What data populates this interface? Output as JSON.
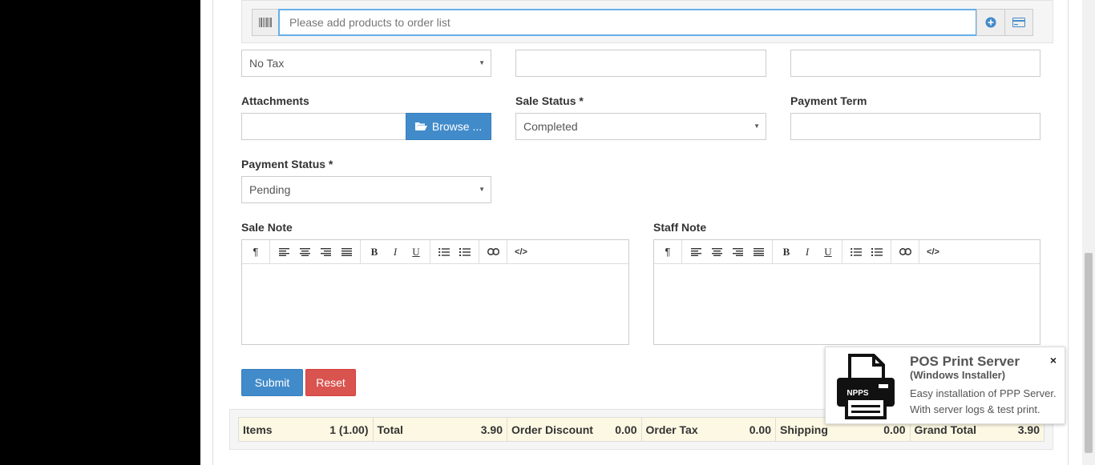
{
  "product_search": {
    "placeholder": "Please add products to order list",
    "barcode_icon": "barcode-icon",
    "add_icon": "plus-circle-icon",
    "card_icon": "credit-card-icon"
  },
  "order_tax": {
    "value": "No Tax"
  },
  "attachments": {
    "label": "Attachments",
    "browse_label": "Browse ..."
  },
  "sale_status": {
    "label": "Sale Status *",
    "value": "Completed"
  },
  "payment_term": {
    "label": "Payment Term"
  },
  "payment_status": {
    "label": "Payment Status *",
    "value": "Pending"
  },
  "sale_note": {
    "label": "Sale Note"
  },
  "staff_note": {
    "label": "Staff Note"
  },
  "toolbar": {
    "paragraph": "¶",
    "bold": "B",
    "italic": "I",
    "underline": "U",
    "code": "</>"
  },
  "actions": {
    "submit": "Submit",
    "reset": "Reset"
  },
  "totals": {
    "items_label": "Items",
    "items_value": "1 (1.00)",
    "total_label": "Total",
    "total_value": "3.90",
    "discount_label": "Order Discount",
    "discount_value": "0.00",
    "tax_label": "Order Tax",
    "tax_value": "0.00",
    "shipping_label": "Shipping",
    "shipping_value": "0.00",
    "grand_label": "Grand Total",
    "grand_value": "3.90"
  },
  "popup": {
    "title": "POS Print Server",
    "subtitle": "(Windows Installer)",
    "line1": "Easy installation of PPP Server.",
    "line2": "With server logs & test print.",
    "logo_text": "NPPS",
    "close": "×"
  },
  "colors": {
    "primary": "#428bca",
    "danger": "#d9534f",
    "totals_bg": "#fcf8e3"
  }
}
